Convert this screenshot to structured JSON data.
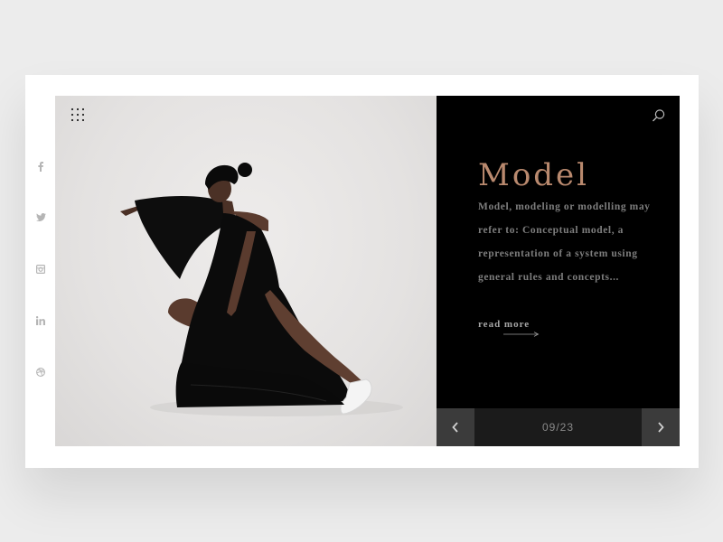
{
  "hero": {
    "title": "Model",
    "description": "Model, modeling or modelling may refer to: Conceptual model, a representation of a system using general rules and concepts...",
    "read_more": "read more",
    "title_color": "#b9896e"
  },
  "pagination": {
    "counter": "09/23",
    "current": 9,
    "total": 23
  },
  "social": [
    {
      "name": "facebook-icon"
    },
    {
      "name": "twitter-icon"
    },
    {
      "name": "instagram-icon"
    },
    {
      "name": "linkedin-icon"
    },
    {
      "name": "dribbble-icon"
    }
  ],
  "icons": {
    "menu": "grid-menu-icon",
    "search": "search-icon",
    "prev": "chevron-left-icon",
    "next": "chevron-right-icon",
    "arrow": "arrow-right-icon"
  }
}
